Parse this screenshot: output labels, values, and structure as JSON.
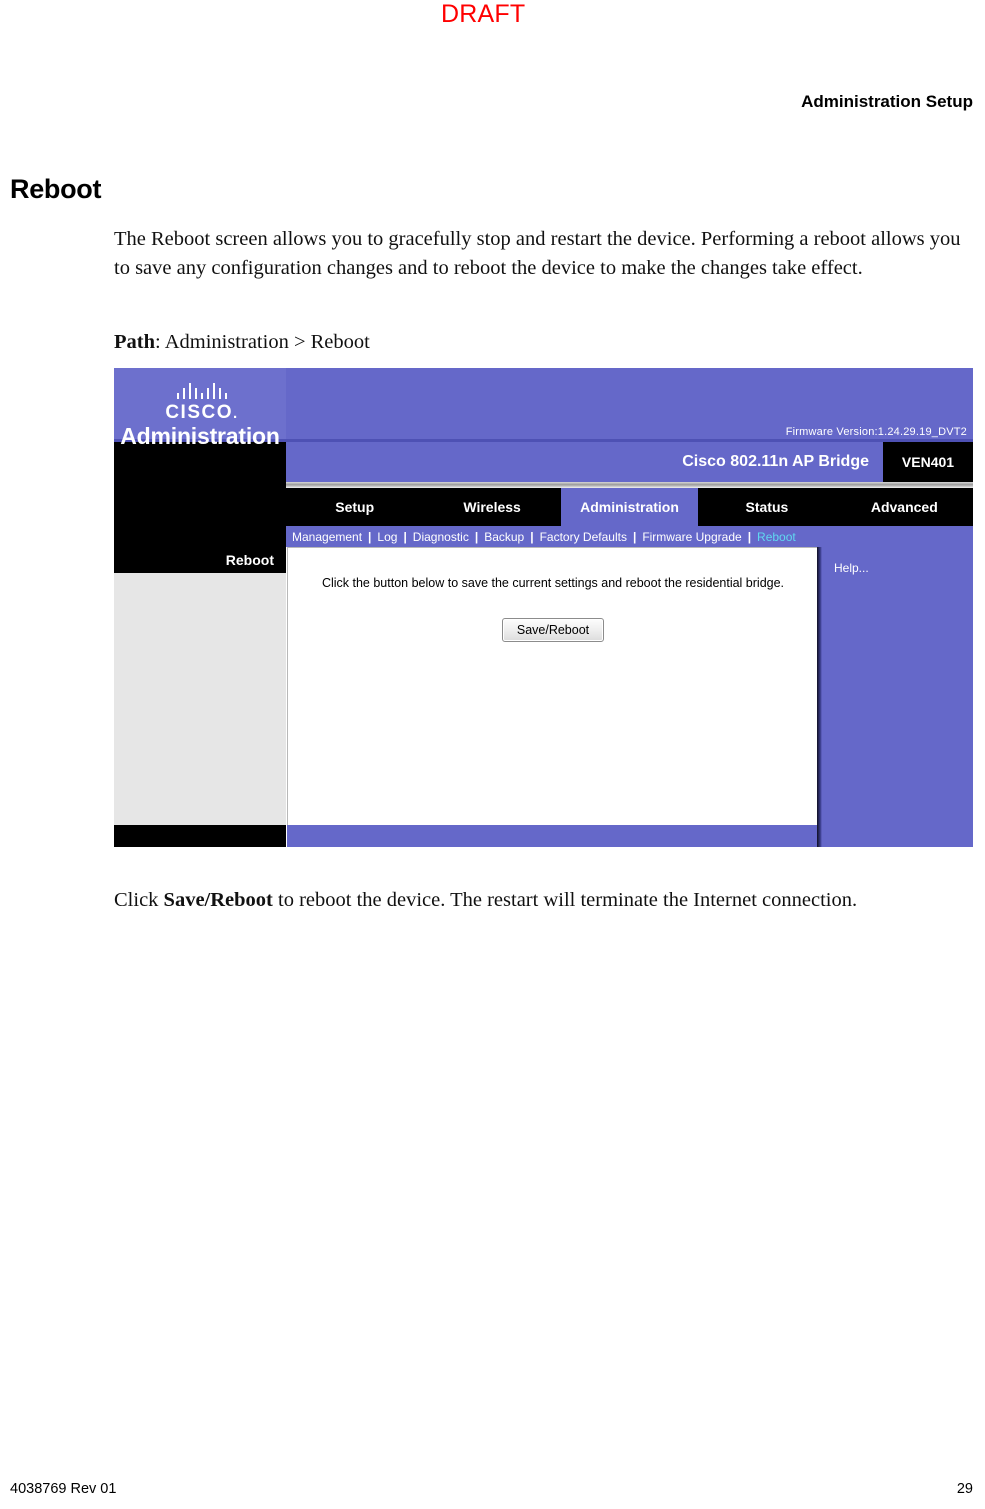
{
  "page": {
    "draft_watermark": "DRAFT",
    "running_head": "Administration Setup",
    "chapter_title": "Reboot",
    "intro_paragraph": "The Reboot screen allows you to gracefully stop and restart the device. Performing a reboot allows you to save any configuration changes and to reboot the device to make the changes take effect.",
    "path_label": "Path",
    "path_value": ": Administration > Reboot",
    "after_click": "Click ",
    "after_bold": "Save/Reboot",
    "after_rest": " to reboot the device. The restart will terminate the Internet connection.",
    "footer_doc_id": "4038769 Rev 01",
    "footer_page_number": "29"
  },
  "screenshot": {
    "brand": {
      "logo_wordmark": "CISCO",
      "logo_dot": ".",
      "firmware": "Firmware Version:1.24.29.19_DVT2"
    },
    "device": {
      "model_name": "Cisco 802.11n AP Bridge",
      "model_code": "VEN401"
    },
    "section_title": "Administration",
    "tabs": [
      {
        "label": "Setup",
        "active": false
      },
      {
        "label": "Wireless",
        "active": false
      },
      {
        "label": "Administration",
        "active": true
      },
      {
        "label": "Status",
        "active": false
      },
      {
        "label": "Advanced",
        "active": false
      }
    ],
    "subnav": [
      {
        "label": "Management",
        "current": false
      },
      {
        "label": "Log",
        "current": false
      },
      {
        "label": "Diagnostic",
        "current": false
      },
      {
        "label": "Backup",
        "current": false
      },
      {
        "label": "Factory Defaults",
        "current": false
      },
      {
        "label": "Firmware Upgrade",
        "current": false
      },
      {
        "label": "Reboot",
        "current": true
      }
    ],
    "subnav_separator": "|",
    "sidebar_heading": "Reboot",
    "content": {
      "instruction": "Click the button below to save the current settings and reboot the residential bridge.",
      "button_label": "Save/Reboot"
    },
    "help": {
      "link_label": "Help..."
    },
    "colors": {
      "purple": "#6568c9",
      "black": "#000000",
      "sidebar_gray": "#e6e6e6",
      "current_link_cyan": "#60d8f0",
      "draft_red": "#ff0000"
    }
  }
}
